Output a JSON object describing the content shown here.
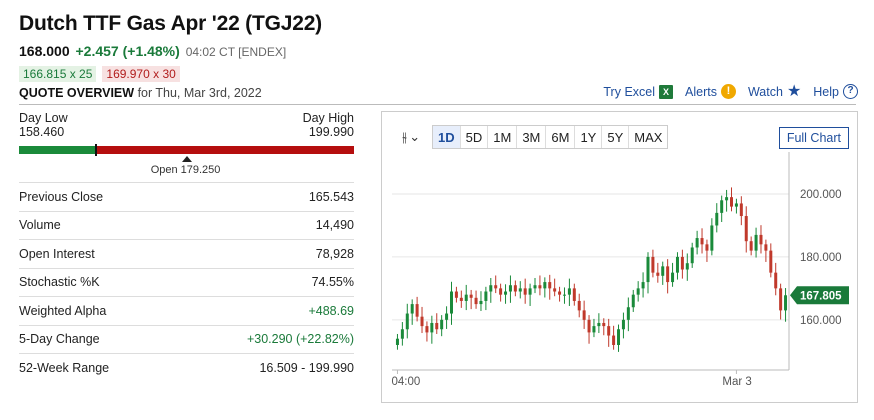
{
  "header": {
    "title": "Dutch TTF Gas Apr '22 (TGJ22)",
    "last": "168.000",
    "change": "+2.457 (+1.48%)",
    "time": "04:02 CT [ENDEX]",
    "bid": "166.815 x 25",
    "ask": "169.970 x 30",
    "overview_heading": "QUOTE OVERVIEW",
    "overview_date": "for Thu, Mar 3rd, 2022"
  },
  "tools": {
    "excel": "Try Excel",
    "alerts": "Alerts",
    "watch": "Watch",
    "help": "Help"
  },
  "range": {
    "low_label": "Day Low",
    "low_value": "158.460",
    "high_label": "Day High",
    "high_value": "199.990",
    "open_label": "Open 179.250",
    "low": 158.46,
    "high": 199.99,
    "last": 168.0,
    "open": 179.25
  },
  "stats": [
    {
      "key": "Previous Close",
      "value": "165.543",
      "positive": false
    },
    {
      "key": "Volume",
      "value": "14,490",
      "positive": false
    },
    {
      "key": "Open Interest",
      "value": "78,928",
      "positive": false
    },
    {
      "key": "Stochastic %K",
      "value": "74.55%",
      "positive": false
    },
    {
      "key": "Weighted Alpha",
      "value": "+488.69",
      "positive": true
    },
    {
      "key": "5-Day Change",
      "value": "+30.290 (+22.82%)",
      "positive": true
    },
    {
      "key": "52-Week Range",
      "value": "16.509 - 199.990",
      "positive": false
    }
  ],
  "chart_panel": {
    "periods": [
      "1D",
      "5D",
      "1M",
      "3M",
      "6M",
      "1Y",
      "5Y",
      "MAX"
    ],
    "active_period": "1D",
    "full_chart": "Full Chart"
  },
  "chart_data": {
    "type": "candlestick",
    "ylim": [
      145,
      207
    ],
    "yticks": [
      160,
      180,
      200
    ],
    "ytick_labels": [
      "160.000",
      "180.000",
      "200.000"
    ],
    "xtick_labels": [
      "04:00",
      "Mar 3"
    ],
    "xtick_at_close": [
      0,
      69
    ],
    "last_label": "167.805",
    "last_value": 167.805,
    "colors": {
      "up": "#1a8a3a",
      "down": "#c0392b",
      "last": "#1a7a3a"
    },
    "closes": [
      154,
      157,
      162,
      165,
      161,
      158,
      156,
      159,
      157,
      160,
      162,
      169,
      167,
      166,
      168,
      167,
      165,
      166,
      169,
      171,
      170,
      168,
      169,
      171,
      169,
      170,
      168,
      170,
      171,
      170,
      172,
      170,
      169,
      168,
      168,
      170,
      166,
      163,
      160,
      156,
      158,
      159,
      158,
      155,
      152,
      157,
      160,
      164,
      168,
      170,
      172,
      180,
      175,
      174,
      177,
      172,
      175,
      180,
      176,
      178,
      183,
      186,
      184,
      182,
      190,
      194,
      198,
      199,
      196,
      197,
      193,
      185,
      182,
      187,
      184,
      182,
      175,
      170,
      163,
      167.805
    ]
  }
}
